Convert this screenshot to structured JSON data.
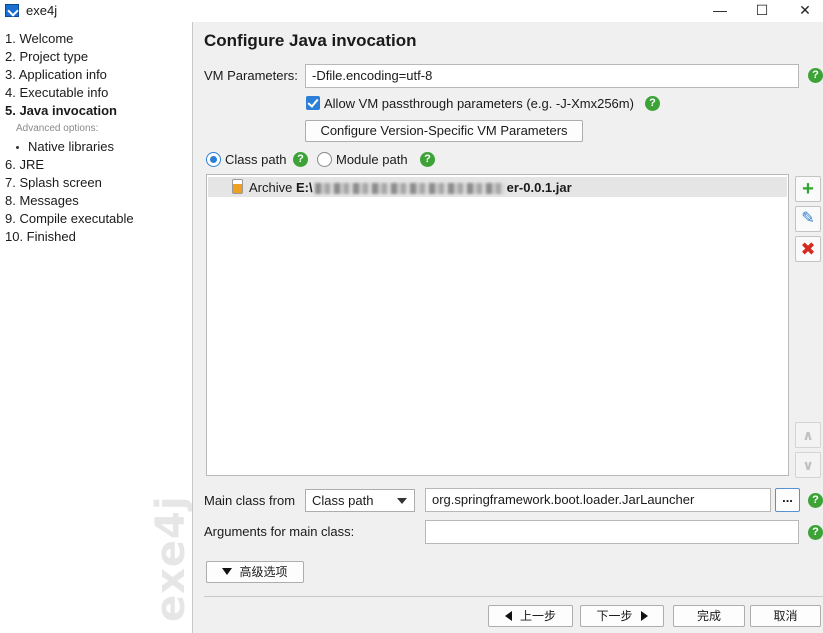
{
  "window": {
    "title": "exe4j",
    "minimize_glyph": "—",
    "maximize_glyph": "☐",
    "close_glyph": "✕"
  },
  "sidebar": {
    "items": [
      {
        "label": "1. Welcome"
      },
      {
        "label": "2. Project type"
      },
      {
        "label": "3. Application info"
      },
      {
        "label": "4. Executable info"
      },
      {
        "label": "5. Java invocation",
        "active": true
      },
      {
        "label": "6. JRE"
      },
      {
        "label": "7. Splash screen"
      },
      {
        "label": "8. Messages"
      },
      {
        "label": "9. Compile executable"
      },
      {
        "label": "10. Finished"
      }
    ],
    "advanced_label": "Advanced options:",
    "advanced_items": [
      {
        "label": "Native libraries"
      }
    ],
    "watermark": "exe4j"
  },
  "main": {
    "title": "Configure Java invocation",
    "vm_parameters": {
      "label": "VM Parameters:",
      "value": "-Dfile.encoding=utf-8"
    },
    "passthrough": {
      "label": "Allow VM passthrough parameters (e.g. -J-Xmx256m)",
      "checked": true
    },
    "version_specific_button": "Configure Version-Specific VM Parameters",
    "path_mode": {
      "class_path": "Class path",
      "module_path": "Module path",
      "selected": "Class path"
    },
    "classpath_entries": [
      {
        "kind": "Archive",
        "path_prefix": "E:\\",
        "path_suffix": "er-0.0.1.jar"
      }
    ],
    "side_buttons": {
      "add": "+",
      "edit": "✎",
      "remove": "✖",
      "up": "∧",
      "down": "∨"
    },
    "main_class": {
      "label": "Main class from",
      "source": "Class path",
      "value": "org.springframework.boot.loader.JarLauncher",
      "browse": "..."
    },
    "arguments": {
      "label": "Arguments for main class:",
      "value": ""
    },
    "advanced_button": "高级选项",
    "help_glyph": "?"
  },
  "footer": {
    "back": "上一步",
    "next": "下一步",
    "finish": "完成",
    "cancel": "取消"
  },
  "colors": {
    "accent": "#2b7fd6",
    "help": "#3da337",
    "add": "#2ea62e",
    "remove": "#d62a1e"
  }
}
